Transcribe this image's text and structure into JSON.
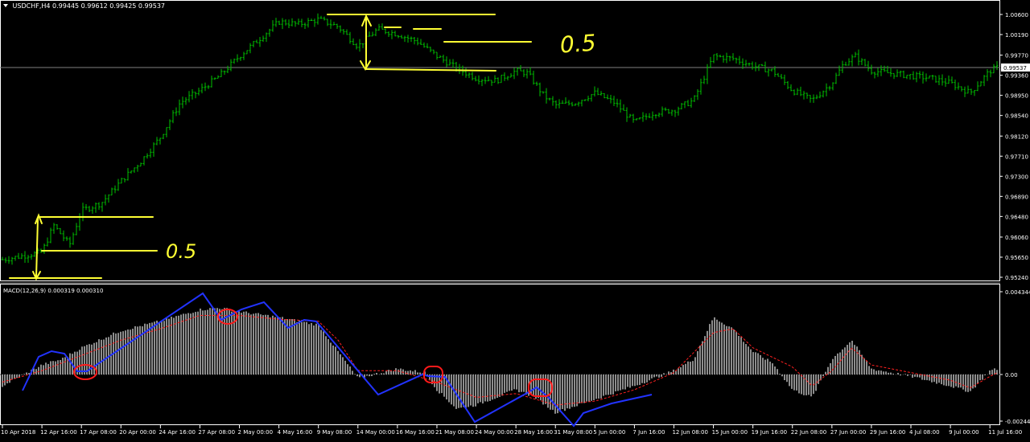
{
  "header": {
    "symbol": "USDCHF,H4",
    "ohlc": "0.99445 0.99612 0.99425 0.99537"
  },
  "macd_header": {
    "label": "MACD(12,26,9) 0.000319 0.000310"
  },
  "colors": {
    "background": "#000000",
    "price_bars": "#00c000",
    "axis": "#ffffff",
    "grid_price_line": "#808080",
    "annotation_yellow": "#ffff33",
    "annotation_blue": "#2233ff",
    "annotation_red": "#ff1a1a",
    "histogram": "#c8c8c8",
    "signal_line": "#ff2020"
  },
  "annotations": {
    "fib_label_left": "0.5",
    "fib_label_right": "0.5"
  },
  "chart_data": [
    {
      "type": "bar",
      "title": "USDCHF,H4",
      "price_axis": [
        "1.00600",
        "1.00190",
        "0.99770",
        "0.99360",
        "0.98950",
        "0.98540",
        "0.98120",
        "0.97710",
        "0.97300",
        "0.96890",
        "0.96480",
        "0.96060",
        "0.95650",
        "0.95240"
      ],
      "current_price": "0.99537",
      "ylim": [
        0.9524,
        1.006
      ],
      "time_axis": [
        "10 Apr 2018",
        "12 Apr 16:00",
        "17 Apr 08:00",
        "20 Apr 00:00",
        "24 Apr 16:00",
        "27 Apr 08:00",
        "2 May 00:00",
        "4 May 16:00",
        "9 May 08:00",
        "14 May 00:00",
        "16 May 16:00",
        "21 May 08:00",
        "24 May 00:00",
        "28 May 16:00",
        "31 May 08:00",
        "5 Jun 00:00",
        "7 Jun 16:00",
        "12 Jun 08:00",
        "15 Jun 00:00",
        "19 Jun 16:00",
        "22 Jun 08:00",
        "27 Jun 00:00",
        "29 Jun 16:00",
        "4 Jul 08:00",
        "9 Jul 00:00",
        "11 Jul 16:00"
      ],
      "close_path": [
        [
          0,
          0.956
        ],
        [
          1,
          0.9575
        ],
        [
          1.3,
          0.963
        ],
        [
          1.7,
          0.959
        ],
        [
          2,
          0.966
        ],
        [
          2.5,
          0.9675
        ],
        [
          3,
          0.972
        ],
        [
          3.5,
          0.976
        ],
        [
          4,
          0.981
        ],
        [
          4.5,
          0.988
        ],
        [
          5,
          0.9905
        ],
        [
          5.5,
          0.9935
        ],
        [
          6,
          0.9975
        ],
        [
          6.5,
          1.001
        ],
        [
          7,
          1.0045
        ],
        [
          7.5,
          1.004
        ],
        [
          8,
          1.005
        ],
        [
          8.5,
          1.0035
        ],
        [
          9,
          0.9995
        ],
        [
          9.5,
          1.003
        ],
        [
          10,
          1.002
        ],
        [
          10.5,
          1.0005
        ],
        [
          11,
          0.9975
        ],
        [
          11.5,
          0.995
        ],
        [
          12,
          0.993
        ],
        [
          12.5,
          0.9925
        ],
        [
          13,
          0.9945
        ],
        [
          13.3,
          0.994
        ],
        [
          13.7,
          0.9895
        ],
        [
          14,
          0.9875
        ],
        [
          14.5,
          0.988
        ],
        [
          15,
          0.99
        ],
        [
          15.5,
          0.988
        ],
        [
          16,
          0.984
        ],
        [
          16.5,
          0.986
        ],
        [
          17,
          0.9865
        ],
        [
          17.5,
          0.9885
        ],
        [
          18,
          0.9975
        ],
        [
          18.5,
          0.997
        ],
        [
          19,
          0.9955
        ],
        [
          19.5,
          0.9945
        ],
        [
          20,
          0.9905
        ],
        [
          20.5,
          0.9885
        ],
        [
          21,
          0.992
        ],
        [
          21.3,
          0.996
        ],
        [
          21.6,
          0.9975
        ],
        [
          22,
          0.9945
        ],
        [
          22.5,
          0.994
        ],
        [
          23,
          0.9935
        ],
        [
          23.5,
          0.993
        ],
        [
          24,
          0.992
        ],
        [
          24.5,
          0.99
        ],
        [
          25,
          0.9945
        ],
        [
          25.2,
          0.9952
        ]
      ]
    },
    {
      "type": "bar",
      "title": "MACD(12,26,9) 0.000319 0.000310",
      "indicator_axis": [
        "0.004344",
        "0.00",
        "-0.002446"
      ],
      "ylim": [
        -0.002446,
        0.004344
      ],
      "histogram_path": [
        [
          0,
          -0.0006
        ],
        [
          1,
          0.0005
        ],
        [
          1.5,
          0.0008
        ],
        [
          2,
          0.0014
        ],
        [
          3,
          0.0023
        ],
        [
          4,
          0.0028
        ],
        [
          5,
          0.0034
        ],
        [
          5.5,
          0.0035
        ],
        [
          6,
          0.0033
        ],
        [
          7,
          0.003
        ],
        [
          7.5,
          0.0028
        ],
        [
          8,
          0.0026
        ],
        [
          8.5,
          0.0012
        ],
        [
          9,
          -0.0002
        ],
        [
          10,
          0.0003
        ],
        [
          10.7,
          0.0001
        ],
        [
          11,
          -0.0008
        ],
        [
          11.5,
          -0.0018
        ],
        [
          12,
          -0.0016
        ],
        [
          13,
          -0.0008
        ],
        [
          13.5,
          -0.0012
        ],
        [
          14,
          -0.002
        ],
        [
          15,
          -0.0013
        ],
        [
          16,
          -0.0006
        ],
        [
          17,
          0.0002
        ],
        [
          17.5,
          0.0008
        ],
        [
          18,
          0.003
        ],
        [
          18.5,
          0.0024
        ],
        [
          19,
          0.0012
        ],
        [
          19.5,
          0.0006
        ],
        [
          20,
          -0.0008
        ],
        [
          20.5,
          -0.0012
        ],
        [
          21,
          0.0008
        ],
        [
          21.5,
          0.0018
        ],
        [
          22,
          0.0003
        ],
        [
          23,
          -0.0001
        ],
        [
          24,
          -0.0006
        ],
        [
          24.5,
          -0.0009
        ],
        [
          25,
          0.0002
        ],
        [
          25.2,
          0.0003
        ]
      ],
      "signal_path": [
        [
          0,
          -0.0004
        ],
        [
          1,
          0.0002
        ],
        [
          2,
          0.001
        ],
        [
          3,
          0.0018
        ],
        [
          4,
          0.0024
        ],
        [
          5,
          0.0031
        ],
        [
          6,
          0.0031
        ],
        [
          7,
          0.0029
        ],
        [
          8,
          0.0028
        ],
        [
          8.5,
          0.0018
        ],
        [
          9,
          0.0002
        ],
        [
          10,
          0.0002
        ],
        [
          11,
          -0.0004
        ],
        [
          12,
          -0.0012
        ],
        [
          13,
          -0.001
        ],
        [
          14,
          -0.0016
        ],
        [
          15,
          -0.0014
        ],
        [
          16,
          -0.0008
        ],
        [
          17,
          0.0001
        ],
        [
          18,
          0.0022
        ],
        [
          18.5,
          0.0024
        ],
        [
          19,
          0.0014
        ],
        [
          20,
          0.0004
        ],
        [
          20.5,
          -0.0006
        ],
        [
          21,
          0.0002
        ],
        [
          21.5,
          0.0014
        ],
        [
          22,
          0.0005
        ],
        [
          23,
          0.0001
        ],
        [
          24,
          -0.0003
        ],
        [
          24.5,
          -0.0007
        ],
        [
          25,
          -0.0001
        ],
        [
          25.2,
          0.0001
        ]
      ]
    }
  ]
}
